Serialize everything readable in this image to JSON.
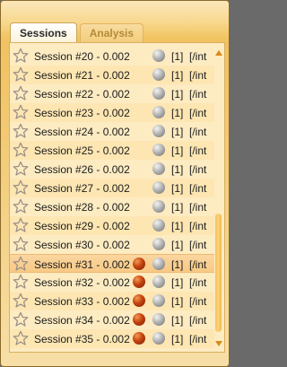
{
  "tabs": [
    {
      "label": "Sessions",
      "active": true
    },
    {
      "label": "Analysis",
      "active": false
    }
  ],
  "icons": {
    "star": "star-outline-icon",
    "status_red": "red-status-dot-icon",
    "status_gray": "gray-status-dot-icon",
    "scroll_up": "scroll-up-arrow-icon",
    "scroll_down": "scroll-down-arrow-icon"
  },
  "colors": {
    "accent": "#f2c563",
    "selected_row": "#f8c985",
    "red_dot": "#c4420f",
    "gray_dot": "#b4b4b4"
  },
  "sessions": [
    {
      "label": "Session #20 - 0.002",
      "count": "[1]",
      "path": "[/int",
      "red": false,
      "selected": false,
      "alt": false
    },
    {
      "label": "Session #21 - 0.002",
      "count": "[1]",
      "path": "[/int",
      "red": false,
      "selected": false,
      "alt": true
    },
    {
      "label": "Session #22 - 0.002",
      "count": "[1]",
      "path": "[/int",
      "red": false,
      "selected": false,
      "alt": false
    },
    {
      "label": "Session #23 - 0.002",
      "count": "[1]",
      "path": "[/int",
      "red": false,
      "selected": false,
      "alt": true
    },
    {
      "label": "Session #24 - 0.002",
      "count": "[1]",
      "path": "[/int",
      "red": false,
      "selected": false,
      "alt": false
    },
    {
      "label": "Session #25 - 0.002",
      "count": "[1]",
      "path": "[/int",
      "red": false,
      "selected": false,
      "alt": true
    },
    {
      "label": "Session #26 - 0.002",
      "count": "[1]",
      "path": "[/int",
      "red": false,
      "selected": false,
      "alt": false
    },
    {
      "label": "Session #27 - 0.002",
      "count": "[1]",
      "path": "[/int",
      "red": false,
      "selected": false,
      "alt": true
    },
    {
      "label": "Session #28 - 0.002",
      "count": "[1]",
      "path": "[/int",
      "red": false,
      "selected": false,
      "alt": false
    },
    {
      "label": "Session #29 - 0.002",
      "count": "[1]",
      "path": "[/int",
      "red": false,
      "selected": false,
      "alt": true
    },
    {
      "label": "Session #30 - 0.002",
      "count": "[1]",
      "path": "[/int",
      "red": false,
      "selected": false,
      "alt": false
    },
    {
      "label": "Session #31 - 0.002",
      "count": "[1]",
      "path": "[/int",
      "red": true,
      "selected": true,
      "alt": false
    },
    {
      "label": "Session #32 - 0.002",
      "count": "[1]",
      "path": "[/int",
      "red": true,
      "selected": false,
      "alt": false
    },
    {
      "label": "Session #33 - 0.002",
      "count": "[1]",
      "path": "[/int",
      "red": true,
      "selected": false,
      "alt": true
    },
    {
      "label": "Session #34 - 0.002",
      "count": "[1]",
      "path": "[/int",
      "red": true,
      "selected": false,
      "alt": false
    },
    {
      "label": "Session #35 - 0.002",
      "count": "[1]",
      "path": "[/int",
      "red": true,
      "selected": false,
      "alt": true
    }
  ]
}
